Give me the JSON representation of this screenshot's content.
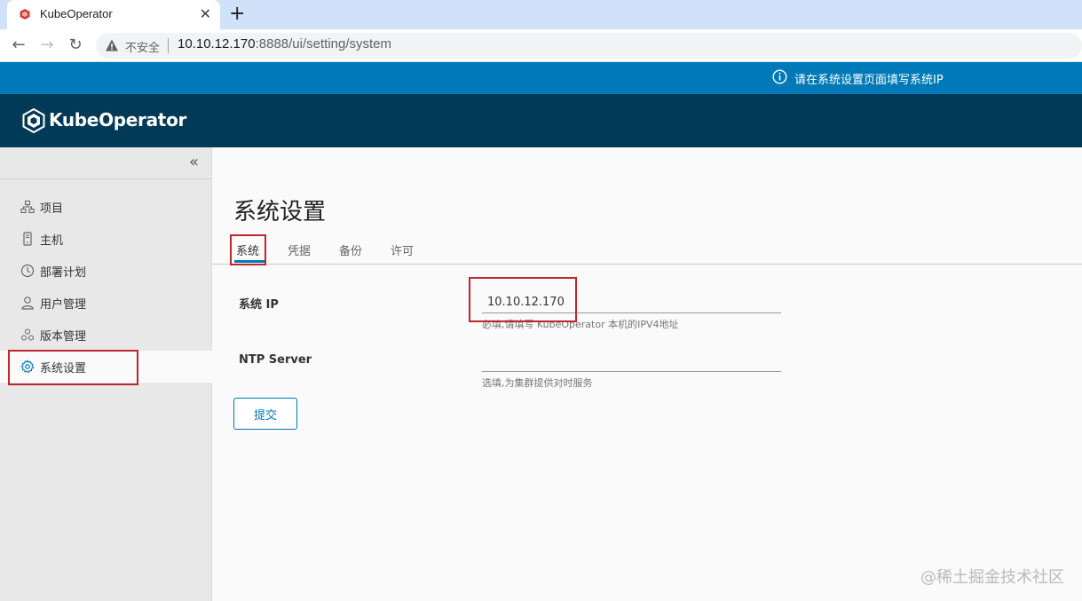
{
  "browser": {
    "tab_title": "KubeOperator",
    "tab_close": "✕",
    "new_tab": "+",
    "back": "←",
    "forward": "→",
    "reload": "↻",
    "security_label": "不安全",
    "url_host": "10.10.12.170",
    "url_rest": ":8888/ui/setting/system"
  },
  "banner": {
    "message": "请在系统设置页面填写系统IP"
  },
  "header": {
    "brand": "KubeOperator"
  },
  "sidebar": {
    "collapse": "«",
    "items": [
      {
        "label": "项目",
        "icon": "project-icon"
      },
      {
        "label": "主机",
        "icon": "host-icon"
      },
      {
        "label": "部署计划",
        "icon": "clock-icon"
      },
      {
        "label": "用户管理",
        "icon": "user-icon"
      },
      {
        "label": "版本管理",
        "icon": "version-icon"
      },
      {
        "label": "系统设置",
        "icon": "gear-icon",
        "active": true
      }
    ]
  },
  "main": {
    "title": "系统设置",
    "tabs": [
      "系统",
      "凭据",
      "备份",
      "许可"
    ],
    "form": {
      "ip_label": "系统 IP",
      "ip_value": "10.10.12.170",
      "ip_helper": "必填,请填写 KubeOperator 本机的IPV4地址",
      "ntp_label": "NTP Server",
      "ntp_value": "",
      "ntp_helper": "选填,为集群提供对时服务",
      "submit": "提交"
    }
  },
  "watermark": "@稀土掘金技术社区",
  "colors": {
    "accent": "#0079b8",
    "header_bg": "#003a57",
    "highlight": "#c0262c"
  }
}
